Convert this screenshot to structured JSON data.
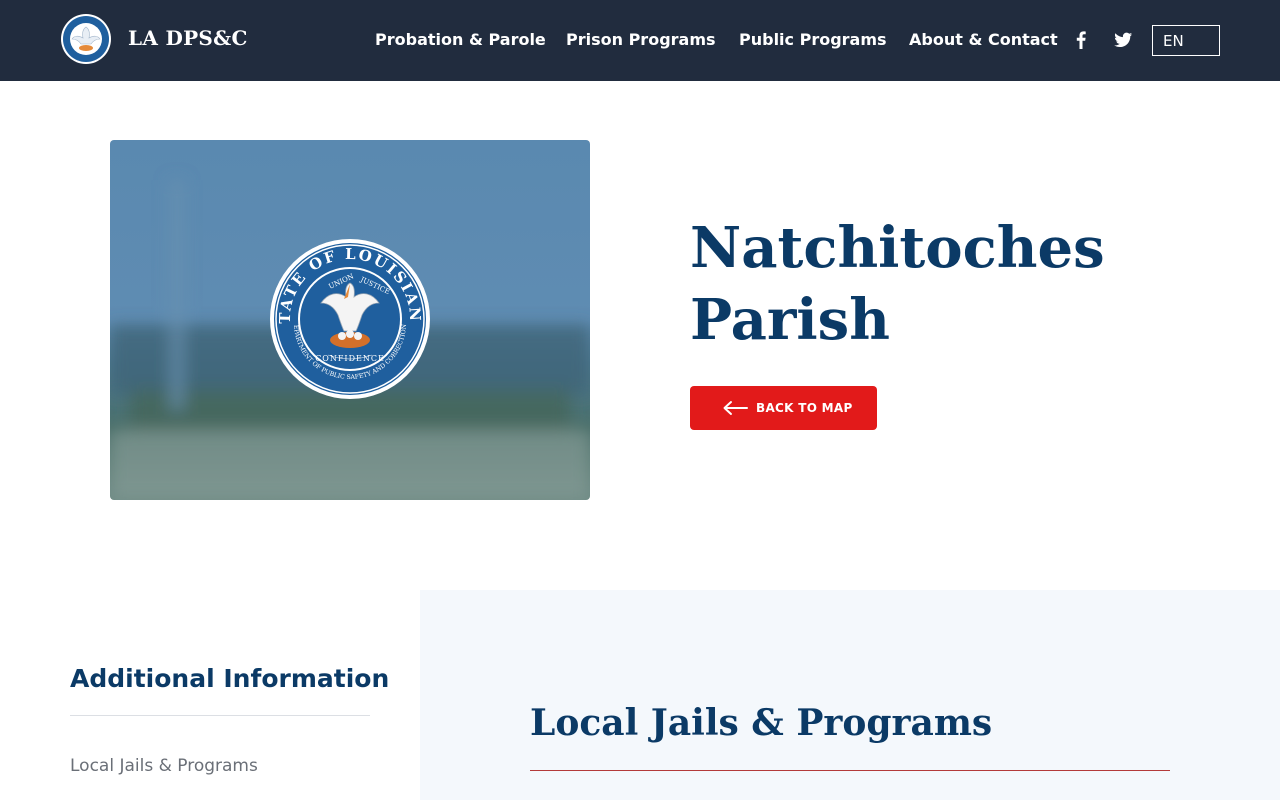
{
  "header": {
    "site_title": "LA DPS&C",
    "nav": [
      {
        "label": "Probation & Parole"
      },
      {
        "label": "Prison Programs"
      },
      {
        "label": "Public Programs"
      },
      {
        "label": "About & Contact"
      }
    ],
    "social_icons": [
      "facebook-icon",
      "twitter-icon"
    ],
    "language": "EN"
  },
  "hero": {
    "title_line1": "Natchitoches",
    "title_line2": "Parish",
    "back_button_label": "BACK TO MAP",
    "seal": {
      "outer_text": "STATE OF LOUISIANA",
      "inner_left": "UNION",
      "inner_right": "JUSTICE",
      "inner_bottom": "CONFIDENCE",
      "bottom_text": "DEPARTMENT OF PUBLIC SAFETY AND CORRECTIONS"
    }
  },
  "sidebar": {
    "title": "Additional Information",
    "links": [
      {
        "label": "Local Jails & Programs"
      }
    ]
  },
  "main": {
    "section_title": "Local Jails & Programs"
  },
  "colors": {
    "header_bg": "#212c3e",
    "primary_navy": "#0b3a66",
    "accent_red": "#e21a1a",
    "panel_bg": "#f4f8fc",
    "seal_blue": "#1f5f9e"
  }
}
